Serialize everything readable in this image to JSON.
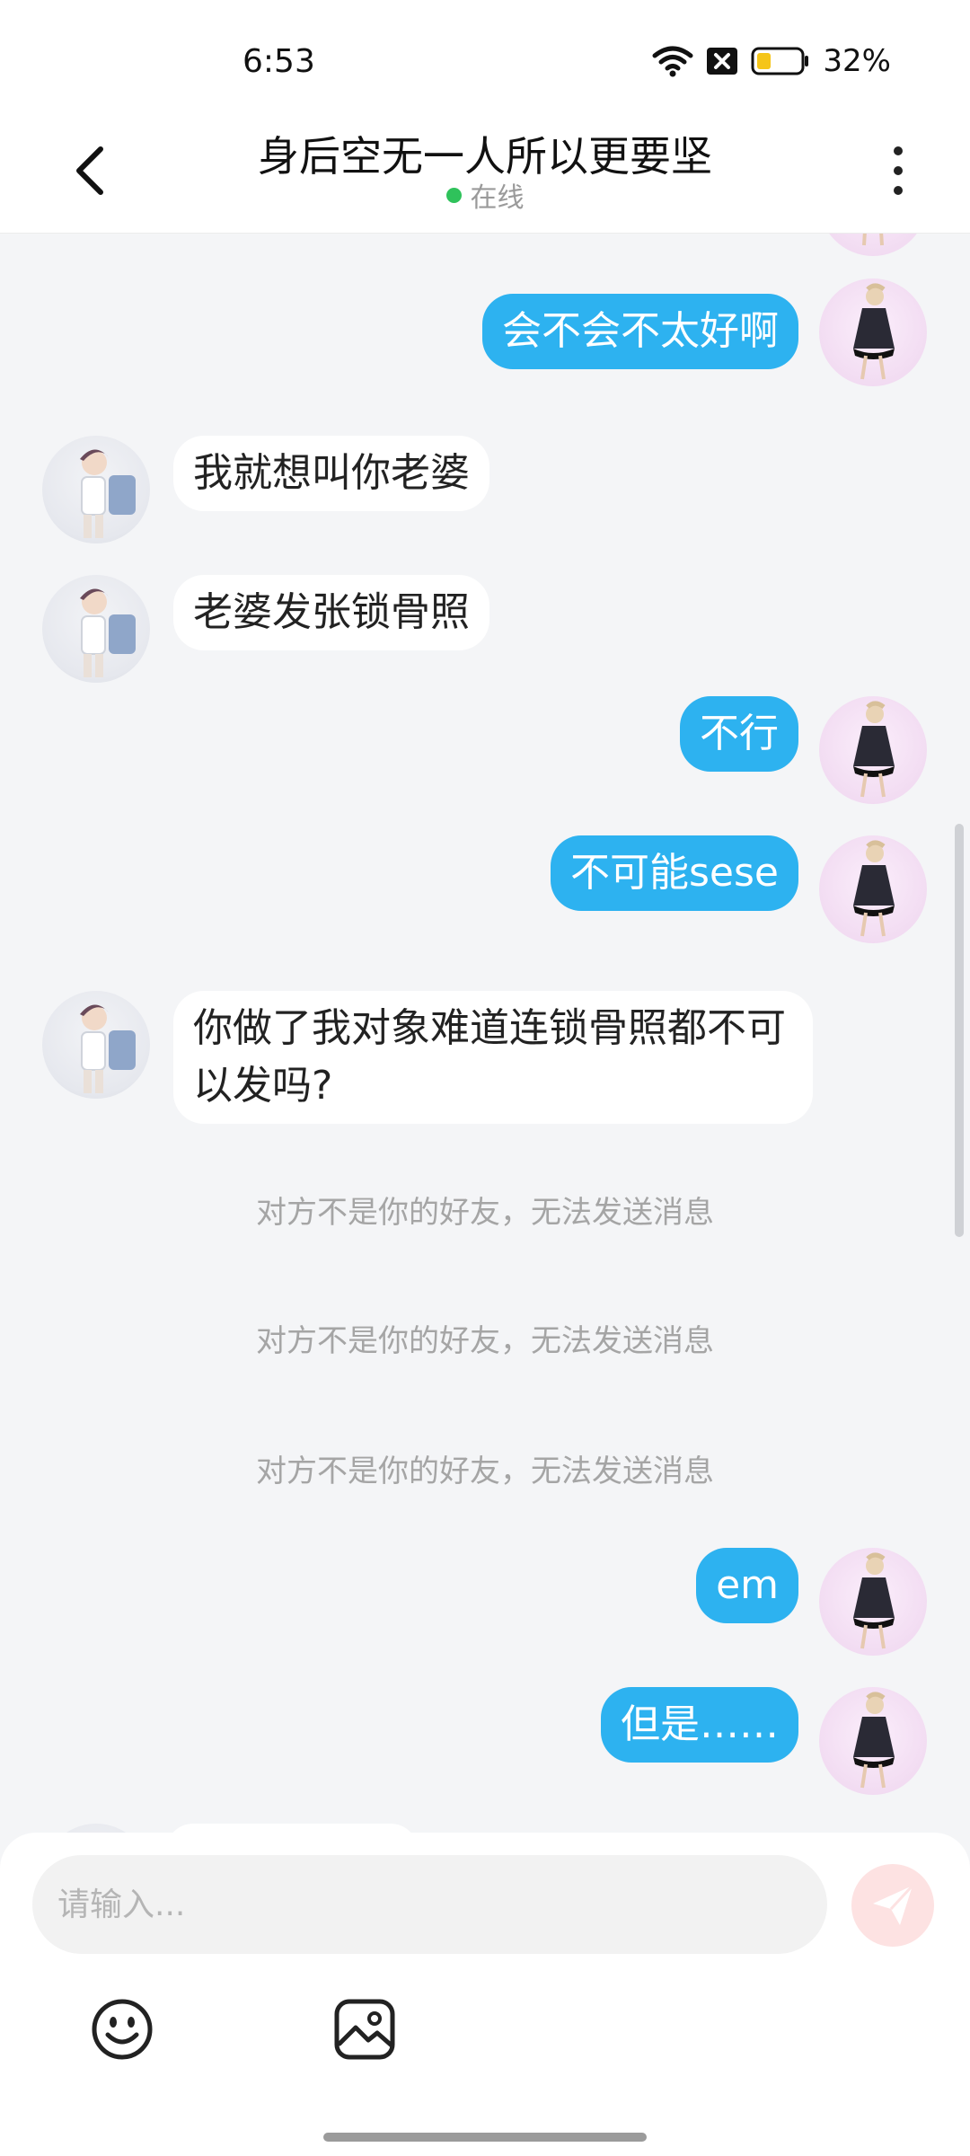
{
  "status_bar": {
    "time": "6:53",
    "battery": "32%",
    "icons": [
      "wifi-icon",
      "sim-off-icon",
      "battery-icon"
    ]
  },
  "header": {
    "title": "身后空无一人所以更要坚",
    "status": "在线"
  },
  "messages": [
    {
      "side": "out",
      "text": "会不会不太好啊"
    },
    {
      "side": "in",
      "text": "我就想叫你老婆"
    },
    {
      "side": "in",
      "text": "老婆发张锁骨照"
    },
    {
      "side": "out",
      "text": "不行"
    },
    {
      "side": "out",
      "text": "不可能sese"
    },
    {
      "side": "in",
      "text": "你做了我对象难道连锁骨照都不可以发吗?"
    },
    {
      "side": "system",
      "text": "对方不是你的好友，无法发送消息"
    },
    {
      "side": "system",
      "text": "对方不是你的好友，无法发送消息"
    },
    {
      "side": "system",
      "text": "对方不是你的好友，无法发送消息"
    },
    {
      "side": "out",
      "text": "em"
    },
    {
      "side": "out",
      "text": "但是……"
    }
  ],
  "composer": {
    "placeholder": "请输入...",
    "value": ""
  },
  "colors": {
    "outgoing_bubble": "#2db2f0",
    "incoming_bubble": "#ffffff",
    "online": "#2fc25b",
    "send_button": "#fde2e2"
  }
}
